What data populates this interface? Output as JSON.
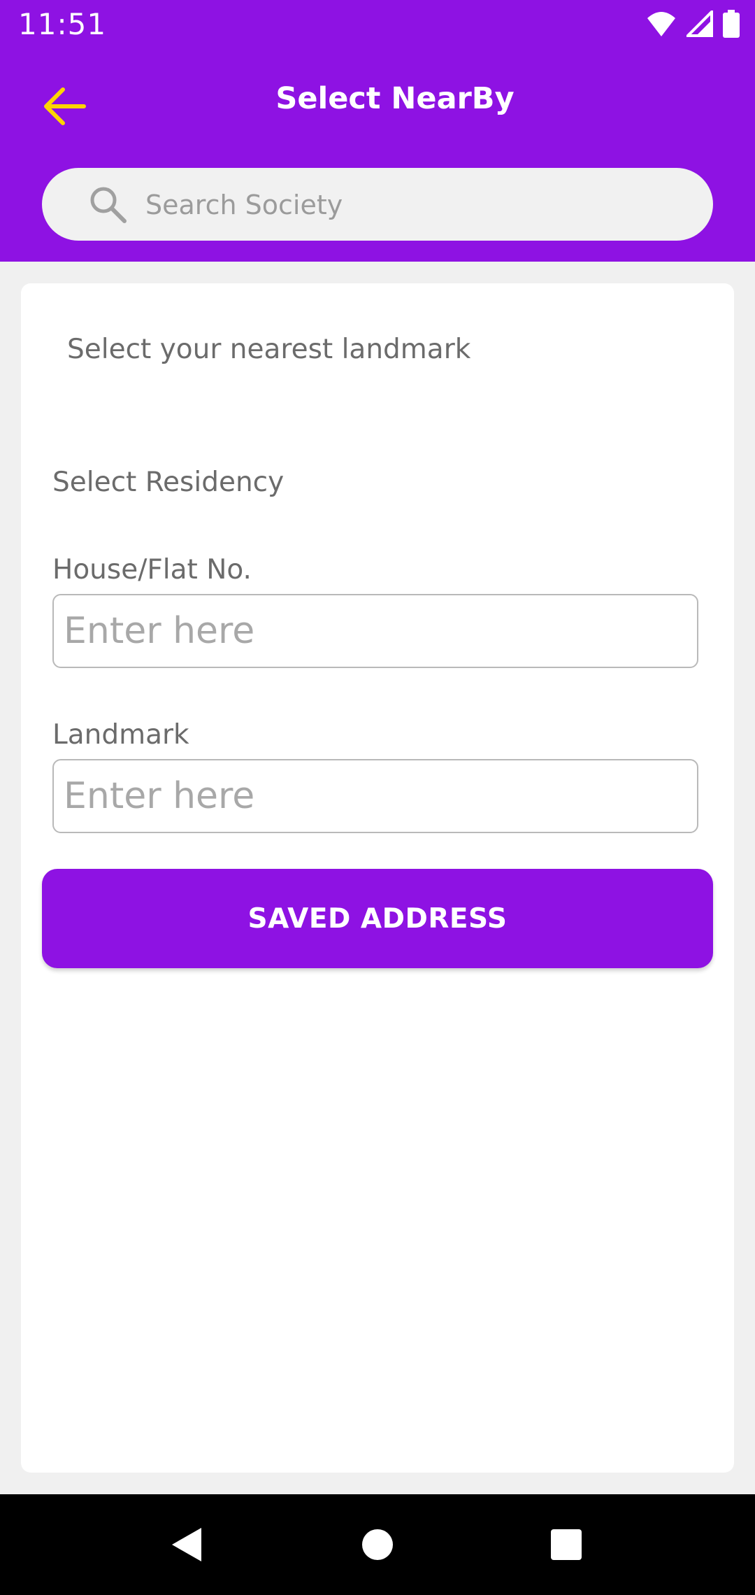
{
  "status_bar": {
    "time": "11:51",
    "icons": [
      "wifi-icon",
      "cellular-signal-icon",
      "battery-icon"
    ]
  },
  "app_bar": {
    "title": "Select NearBy",
    "back_icon": "arrow-left-icon"
  },
  "search": {
    "placeholder": "Search Society",
    "icon": "search-icon"
  },
  "form": {
    "prompt": "Select your nearest landmark",
    "residency_label": "Select Residency",
    "house_label": "House/Flat No.",
    "house_placeholder": "Enter here",
    "house_value": "",
    "landmark_label": "Landmark",
    "landmark_placeholder": "Enter here",
    "landmark_value": ""
  },
  "actions": {
    "saved_address_label": "SAVED ADDRESS"
  },
  "nav_bar": {
    "icons": [
      "back-triangle-icon",
      "home-circle-icon",
      "recents-square-icon"
    ]
  },
  "colors": {
    "primary": "#8e12e3",
    "accent_back_arrow": "#ffd400",
    "background": "#f0f0f0",
    "card": "#ffffff"
  }
}
